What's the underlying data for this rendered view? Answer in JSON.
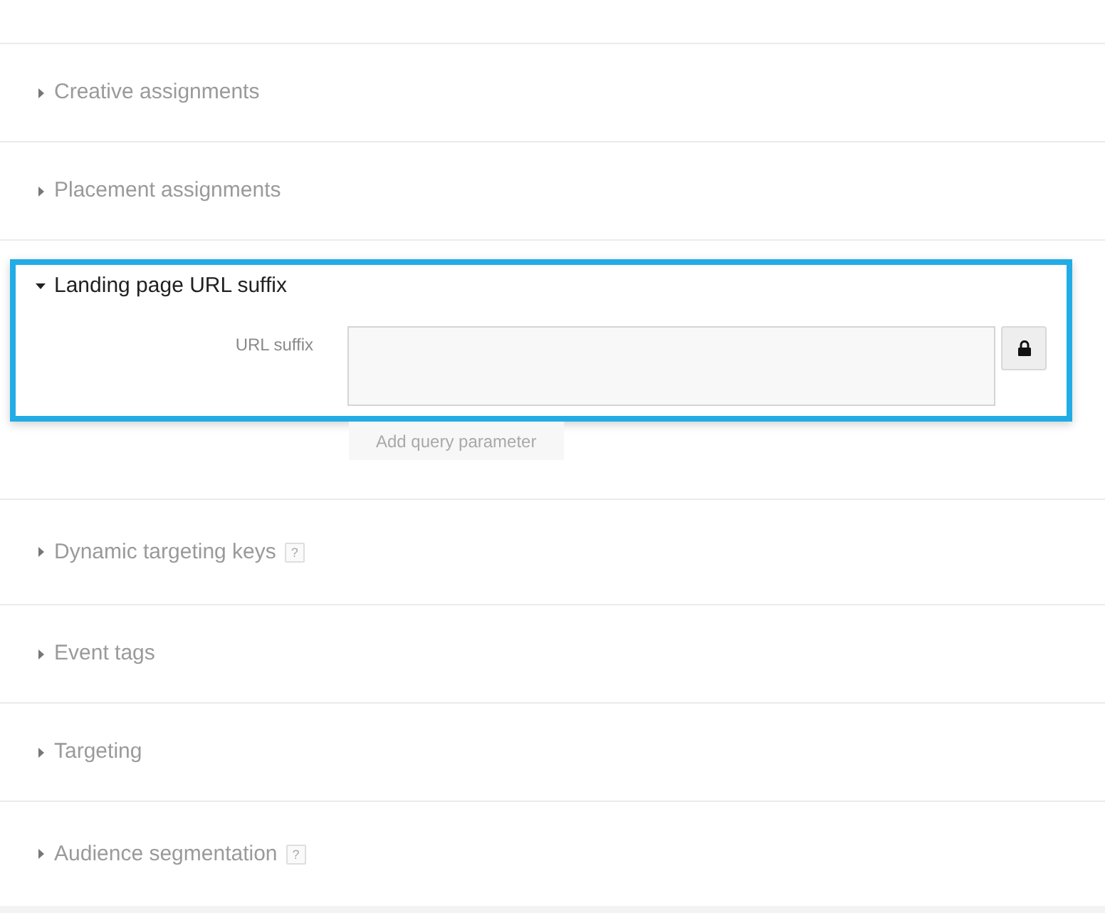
{
  "sections": [
    {
      "title": "Creative assignments",
      "expanded": false
    },
    {
      "title": "Placement assignments",
      "expanded": false
    },
    {
      "title": "Landing page URL suffix",
      "expanded": true,
      "highlighted": true,
      "field": {
        "label": "URL suffix"
      },
      "add_button": {
        "label": "Add query parameter",
        "disabled": true
      }
    },
    {
      "title": "Dynamic targeting keys",
      "expanded": false,
      "help": "?"
    },
    {
      "title": "Event tags",
      "expanded": false
    },
    {
      "title": "Targeting",
      "expanded": false
    },
    {
      "title": "Audience segmentation",
      "expanded": false,
      "help": "?"
    }
  ]
}
